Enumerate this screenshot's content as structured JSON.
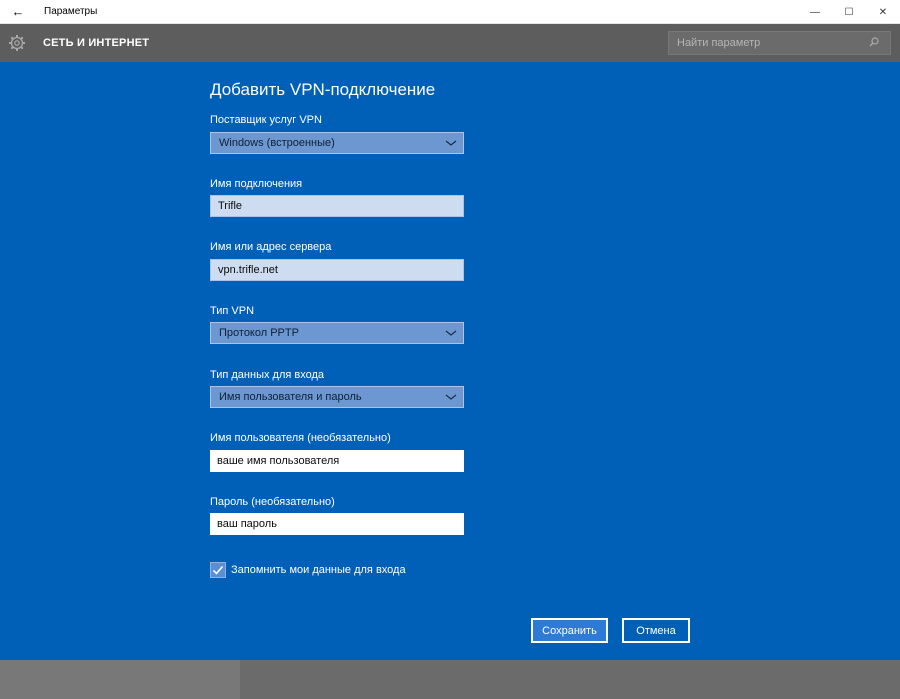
{
  "window": {
    "title": "Параметры",
    "back_glyph": "←",
    "minimize_glyph": "—",
    "maximize_glyph": "☐",
    "close_glyph": "✕"
  },
  "header": {
    "section_title": "СЕТЬ И ИНТЕРНЕТ",
    "search_placeholder": "Найти параметр"
  },
  "form": {
    "title": "Добавить VPN-подключение",
    "provider": {
      "label": "Поставщик услуг VPN",
      "value": "Windows (встроенные)"
    },
    "connection_name": {
      "label": "Имя подключения",
      "value": "Trifle"
    },
    "server": {
      "label": "Имя или адрес сервера",
      "value": "vpn.trifle.net"
    },
    "vpn_type": {
      "label": "Тип VPN",
      "value": "Протокол PPTP"
    },
    "signin_type": {
      "label": "Тип данных для входа",
      "value": "Имя пользователя и пароль"
    },
    "username": {
      "label": "Имя пользователя (необязательно)",
      "value": "ваше имя пользователя"
    },
    "password": {
      "label": "Пароль (необязательно)",
      "value": "ваш пароль"
    },
    "remember": {
      "label": "Запомнить мои данные для входа",
      "checked": true
    }
  },
  "buttons": {
    "save": "Сохранить",
    "cancel": "Отмена"
  },
  "colors": {
    "panel": "#0060b8",
    "header": "#5d5d5d",
    "save_button": "#2d7bd6"
  }
}
